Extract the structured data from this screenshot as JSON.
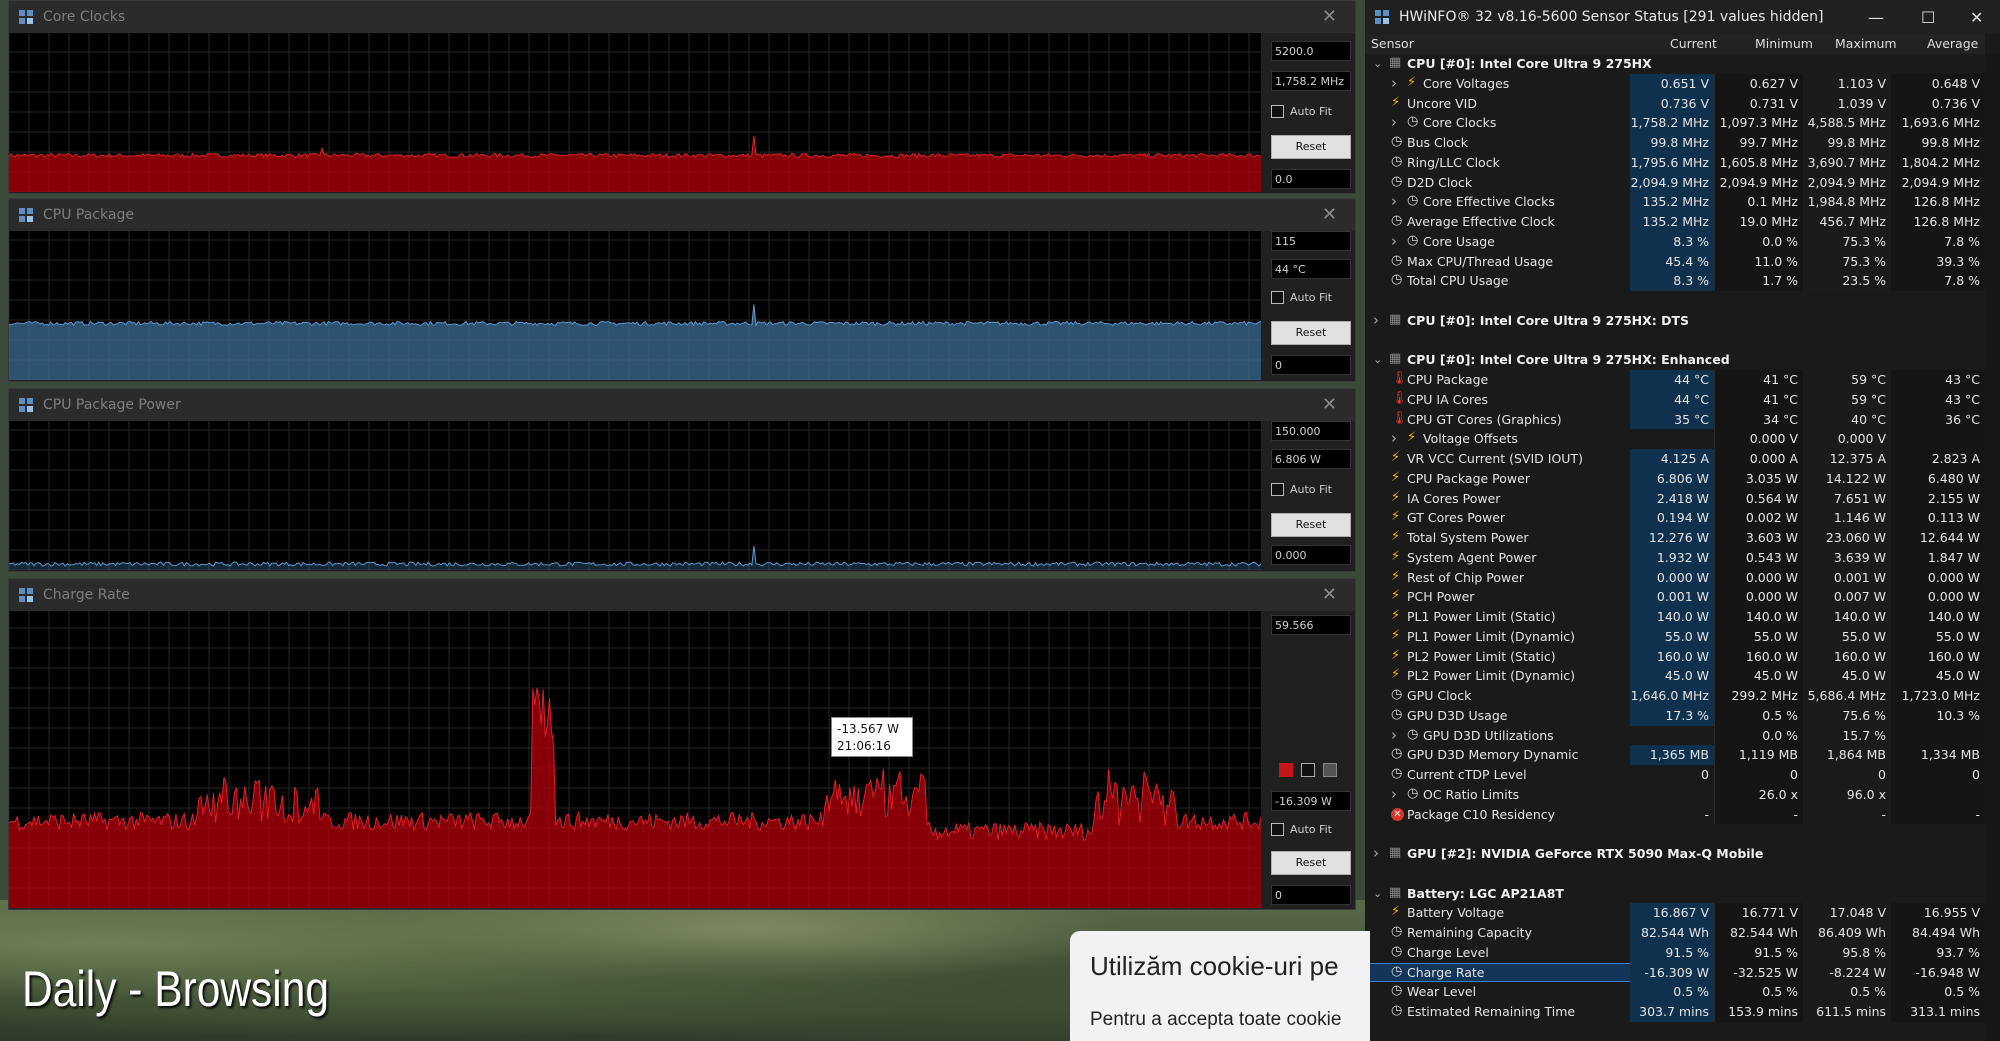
{
  "overlay": {
    "title": "Daily - Browsing"
  },
  "cookie": {
    "title": "Utilizăm cookie-uri pe",
    "body": "Pentru a accepta toate cookie"
  },
  "colors": {
    "graph_red": "#b5000a",
    "graph_blue": "#3c6e96",
    "grid": "#262626",
    "highlight": "#10314e"
  },
  "graphs": [
    {
      "title": "Core Clocks",
      "top_value": "5200.0",
      "current": "1,758.2 MHz",
      "bottom_value": "0.0",
      "autofit": "Auto Fit",
      "reset": "Reset",
      "series_level": 0.23,
      "color": "red"
    },
    {
      "title": "CPU Package",
      "top_value": "115",
      "current": "44 °C",
      "bottom_value": "0",
      "autofit": "Auto Fit",
      "reset": "Reset",
      "series_level": 0.38,
      "color": "blue"
    },
    {
      "title": "CPU Package Power",
      "top_value": "150.000",
      "current": "6.806 W",
      "bottom_value": "0.000",
      "autofit": "Auto Fit",
      "reset": "Reset",
      "series_level": 0.04,
      "color": "blue"
    },
    {
      "title": "Charge Rate",
      "top_value": "59.566",
      "current": "-16.309 W",
      "bottom_value": "0",
      "autofit": "Auto Fit",
      "reset": "Reset",
      "series_level": 0.28,
      "color": "red",
      "tooltip_value": "-13.567 W",
      "tooltip_time": "21:06:16"
    }
  ],
  "hwinfo": {
    "title": "HWiNFO® 32 v8.16-5600 Sensor Status [291 values hidden]",
    "headers": {
      "sensor": "Sensor",
      "current": "Current",
      "min": "Minimum",
      "max": "Maximum",
      "avg": "Average"
    },
    "rows": [
      {
        "type": "group",
        "label": "CPU [#0]: Intel Core Ultra 9 275HX",
        "exp": "v"
      },
      {
        "label": "Core Voltages",
        "icon": "bolt",
        "sub": true,
        "cur": "0.651 V",
        "min": "0.627 V",
        "max": "1.103 V",
        "avg": "0.648 V"
      },
      {
        "label": "Uncore VID",
        "icon": "bolt",
        "cur": "0.736 V",
        "min": "0.731 V",
        "max": "1.039 V",
        "avg": "0.736 V"
      },
      {
        "label": "Core Clocks",
        "icon": "clock",
        "sub": true,
        "cur": "1,758.2 MHz",
        "min": "1,097.3 MHz",
        "max": "4,588.5 MHz",
        "avg": "1,693.6 MHz"
      },
      {
        "label": "Bus Clock",
        "icon": "clock",
        "cur": "99.8 MHz",
        "min": "99.7 MHz",
        "max": "99.8 MHz",
        "avg": "99.8 MHz"
      },
      {
        "label": "Ring/LLC Clock",
        "icon": "clock",
        "cur": "1,795.6 MHz",
        "min": "1,605.8 MHz",
        "max": "3,690.7 MHz",
        "avg": "1,804.2 MHz"
      },
      {
        "label": "D2D Clock",
        "icon": "clock",
        "cur": "2,094.9 MHz",
        "min": "2,094.9 MHz",
        "max": "2,094.9 MHz",
        "avg": "2,094.9 MHz"
      },
      {
        "label": "Core Effective Clocks",
        "icon": "clock",
        "sub": true,
        "cur": "135.2 MHz",
        "min": "0.1 MHz",
        "max": "1,984.8 MHz",
        "avg": "126.8 MHz"
      },
      {
        "label": "Average Effective Clock",
        "icon": "clock",
        "cur": "135.2 MHz",
        "min": "19.0 MHz",
        "max": "456.7 MHz",
        "avg": "126.8 MHz"
      },
      {
        "label": "Core Usage",
        "icon": "clock",
        "sub": true,
        "cur": "8.3 %",
        "min": "0.0 %",
        "max": "75.3 %",
        "avg": "7.8 %"
      },
      {
        "label": "Max CPU/Thread Usage",
        "icon": "clock",
        "cur": "45.4 %",
        "min": "11.0 %",
        "max": "75.3 %",
        "avg": "39.3 %"
      },
      {
        "label": "Total CPU Usage",
        "icon": "clock",
        "cur": "8.3 %",
        "min": "1.7 %",
        "max": "23.5 %",
        "avg": "7.8 %"
      },
      {
        "type": "blank"
      },
      {
        "type": "group",
        "label": "CPU [#0]: Intel Core Ultra 9 275HX: DTS",
        "exp": ">"
      },
      {
        "type": "blank"
      },
      {
        "type": "group",
        "label": "CPU [#0]: Intel Core Ultra 9 275HX: Enhanced",
        "exp": "v"
      },
      {
        "label": "CPU Package",
        "icon": "therm",
        "cur": "44 °C",
        "min": "41 °C",
        "max": "59 °C",
        "avg": "43 °C"
      },
      {
        "label": "CPU IA Cores",
        "icon": "therm",
        "cur": "44 °C",
        "min": "41 °C",
        "max": "59 °C",
        "avg": "43 °C"
      },
      {
        "label": "CPU GT Cores (Graphics)",
        "icon": "therm",
        "cur": "35 °C",
        "min": "34 °C",
        "max": "40 °C",
        "avg": "36 °C"
      },
      {
        "label": "Voltage Offsets",
        "icon": "bolt",
        "sub": true,
        "cur": "",
        "min": "0.000 V",
        "max": "0.000 V",
        "avg": ""
      },
      {
        "label": "VR VCC Current (SVID IOUT)",
        "icon": "bolt",
        "cur": "4.125 A",
        "min": "0.000 A",
        "max": "12.375 A",
        "avg": "2.823 A"
      },
      {
        "label": "CPU Package Power",
        "icon": "bolt",
        "cur": "6.806 W",
        "min": "3.035 W",
        "max": "14.122 W",
        "avg": "6.480 W"
      },
      {
        "label": "IA Cores Power",
        "icon": "bolt",
        "cur": "2.418 W",
        "min": "0.564 W",
        "max": "7.651 W",
        "avg": "2.155 W"
      },
      {
        "label": "GT Cores Power",
        "icon": "bolt",
        "cur": "0.194 W",
        "min": "0.002 W",
        "max": "1.146 W",
        "avg": "0.113 W"
      },
      {
        "label": "Total System Power",
        "icon": "bolt",
        "cur": "12.276 W",
        "min": "3.603 W",
        "max": "23.060 W",
        "avg": "12.644 W"
      },
      {
        "label": "System Agent Power",
        "icon": "bolt",
        "cur": "1.932 W",
        "min": "0.543 W",
        "max": "3.639 W",
        "avg": "1.847 W"
      },
      {
        "label": "Rest of Chip Power",
        "icon": "bolt",
        "cur": "0.000 W",
        "min": "0.000 W",
        "max": "0.001 W",
        "avg": "0.000 W"
      },
      {
        "label": "PCH Power",
        "icon": "bolt",
        "cur": "0.001 W",
        "min": "0.000 W",
        "max": "0.007 W",
        "avg": "0.000 W"
      },
      {
        "label": "PL1 Power Limit (Static)",
        "icon": "bolt",
        "cur": "140.0 W",
        "min": "140.0 W",
        "max": "140.0 W",
        "avg": "140.0 W"
      },
      {
        "label": "PL1 Power Limit (Dynamic)",
        "icon": "bolt",
        "cur": "55.0 W",
        "min": "55.0 W",
        "max": "55.0 W",
        "avg": "55.0 W"
      },
      {
        "label": "PL2 Power Limit (Static)",
        "icon": "bolt",
        "cur": "160.0 W",
        "min": "160.0 W",
        "max": "160.0 W",
        "avg": "160.0 W"
      },
      {
        "label": "PL2 Power Limit (Dynamic)",
        "icon": "bolt",
        "cur": "45.0 W",
        "min": "45.0 W",
        "max": "45.0 W",
        "avg": "45.0 W"
      },
      {
        "label": "GPU Clock",
        "icon": "clock",
        "cur": "1,646.0 MHz",
        "min": "299.2 MHz",
        "max": "5,686.4 MHz",
        "avg": "1,723.0 MHz"
      },
      {
        "label": "GPU D3D Usage",
        "icon": "clock",
        "cur": "17.3 %",
        "min": "0.5 %",
        "max": "75.6 %",
        "avg": "10.3 %"
      },
      {
        "label": "GPU D3D Utilizations",
        "icon": "clock",
        "sub": true,
        "cur": "",
        "min": "0.0 %",
        "max": "15.7 %",
        "avg": ""
      },
      {
        "label": "GPU D3D Memory Dynamic",
        "icon": "clock",
        "cur": "1,365 MB",
        "min": "1,119 MB",
        "max": "1,864 MB",
        "avg": "1,334 MB"
      },
      {
        "label": "Current cTDP Level",
        "icon": "clock",
        "cur": "0",
        "min": "0",
        "max": "0",
        "avg": "0"
      },
      {
        "label": "OC Ratio Limits",
        "icon": "clock",
        "sub": true,
        "cur": "",
        "min": "26.0 x",
        "max": "96.0 x",
        "avg": ""
      },
      {
        "label": "Package C10 Residency",
        "icon": "x",
        "cur": "-",
        "min": "-",
        "max": "-",
        "avg": "-"
      },
      {
        "type": "blank"
      },
      {
        "type": "group",
        "label": "GPU [#2]: NVIDIA  GeForce RTX 5090 Max-Q Mobile",
        "exp": ">"
      },
      {
        "type": "blank"
      },
      {
        "type": "group",
        "label": "Battery: LGC AP21A8T",
        "exp": "v"
      },
      {
        "label": "Battery Voltage",
        "icon": "bolt",
        "cur": "16.867 V",
        "min": "16.771 V",
        "max": "17.048 V",
        "avg": "16.955 V"
      },
      {
        "label": "Remaining Capacity",
        "icon": "clock",
        "cur": "82.544 Wh",
        "min": "82.544 Wh",
        "max": "86.409 Wh",
        "avg": "84.494 Wh"
      },
      {
        "label": "Charge Level",
        "icon": "clock",
        "cur": "91.5 %",
        "min": "91.5 %",
        "max": "95.8 %",
        "avg": "93.7 %"
      },
      {
        "label": "Charge Rate",
        "icon": "clock",
        "sel": true,
        "cur": "-16.309 W",
        "min": "-32.525 W",
        "max": "-8.224 W",
        "avg": "-16.948 W"
      },
      {
        "label": "Wear Level",
        "icon": "clock",
        "cur": "0.5 %",
        "min": "0.5 %",
        "max": "0.5 %",
        "avg": "0.5 %"
      },
      {
        "label": "Estimated Remaining Time",
        "icon": "clock",
        "cur": "303.7 mins",
        "min": "153.9 mins",
        "max": "611.5 mins",
        "avg": "313.1 mins"
      }
    ]
  }
}
